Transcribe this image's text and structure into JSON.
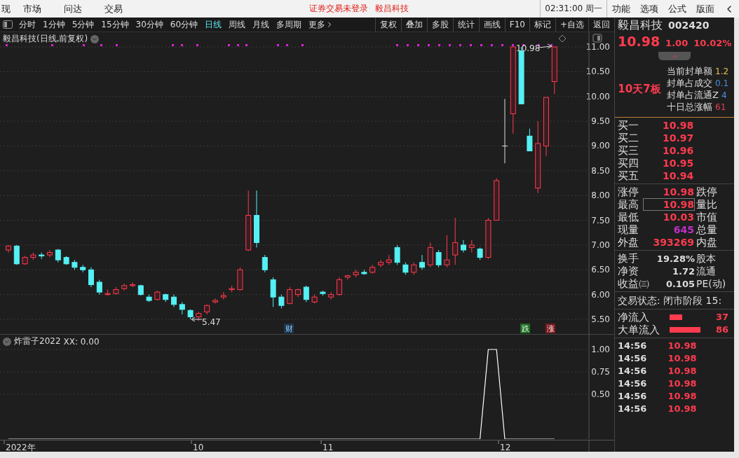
{
  "top_bar": {
    "menu_left": [
      "现",
      "市场",
      "问达",
      "交易"
    ],
    "notice": "证券交易未登录",
    "stock": "毅昌科技",
    "clock": "02:31:00 周一",
    "menu_right": [
      "功能",
      "选项",
      "公式",
      "版面"
    ]
  },
  "toolbar": {
    "periods": [
      {
        "label": "分时",
        "selected": false
      },
      {
        "label": "1分钟",
        "selected": false
      },
      {
        "label": "5分钟",
        "selected": false
      },
      {
        "label": "15分钟",
        "selected": false
      },
      {
        "label": "30分钟",
        "selected": false
      },
      {
        "label": "60分钟",
        "selected": false
      },
      {
        "label": "日线",
        "selected": true
      },
      {
        "label": "周线",
        "selected": false
      },
      {
        "label": "月线",
        "selected": false
      },
      {
        "label": "多周期",
        "selected": false
      },
      {
        "label": "更多",
        "selected": false
      }
    ],
    "tools": [
      "复权",
      "叠加",
      "多股",
      "统计",
      "画线",
      "F10",
      "标记",
      "+自选",
      "返回"
    ]
  },
  "chart": {
    "title": "毅昌科技(日线,前复权)",
    "high_note": "10.98",
    "low_note": "5.47",
    "markers": [
      {
        "label": "财",
        "kind": "finance"
      },
      {
        "label": "跌",
        "kind": "down"
      },
      {
        "label": "涨",
        "kind": "up"
      }
    ],
    "chart_data": {
      "type": "candlestick",
      "grid": true,
      "ylim": [
        5.5,
        11.0
      ],
      "yticks": [
        {
          "value": 11,
          "label": "11.00"
        },
        {
          "value": 10.5,
          "label": "10.50"
        },
        {
          "value": 10,
          "label": "10.00"
        },
        {
          "value": 9.5,
          "label": "9.50"
        },
        {
          "value": 9,
          "label": "9.00"
        },
        {
          "value": 8.5,
          "label": "8.50"
        },
        {
          "value": 8,
          "label": "8.00"
        },
        {
          "value": 7.5,
          "label": "7.50"
        },
        {
          "value": 7,
          "label": "7.00"
        },
        {
          "value": 6.5,
          "label": "6.50"
        },
        {
          "value": 6,
          "label": "6.00"
        },
        {
          "value": 5.5,
          "label": "5.50"
        }
      ],
      "categories": [
        null,
        null,
        null,
        null,
        null,
        null,
        null,
        null,
        null,
        null,
        null,
        null,
        null,
        null,
        null,
        null,
        null,
        null,
        null,
        null,
        null,
        null,
        null,
        null,
        null,
        null,
        null,
        null,
        null,
        null,
        null,
        null,
        null,
        null,
        null,
        null,
        null,
        null,
        null,
        null,
        null,
        null,
        null,
        null,
        null,
        null,
        null,
        null,
        null,
        null,
        null,
        null,
        null,
        null,
        null,
        null,
        null,
        null,
        null,
        null,
        null,
        null,
        null,
        null,
        null,
        null,
        null
      ],
      "ohlc": [
        [
          6.9,
          7.0,
          6.85,
          6.98
        ],
        [
          6.98,
          7.0,
          6.6,
          6.62
        ],
        [
          6.62,
          6.78,
          6.6,
          6.75
        ],
        [
          6.75,
          6.85,
          6.7,
          6.8
        ],
        [
          6.8,
          6.85,
          6.72,
          6.78
        ],
        [
          6.8,
          6.9,
          6.75,
          6.85
        ],
        [
          6.9,
          6.92,
          6.65,
          6.7
        ],
        [
          6.75,
          6.78,
          6.6,
          6.62
        ],
        [
          6.65,
          6.7,
          6.5,
          6.55
        ],
        [
          6.55,
          6.6,
          6.45,
          6.5
        ],
        [
          6.5,
          6.55,
          6.15,
          6.2
        ],
        [
          6.25,
          6.3,
          6.0,
          6.05
        ],
        [
          6.0,
          6.1,
          5.98,
          6.02
        ],
        [
          6.02,
          6.15,
          6.0,
          6.1
        ],
        [
          6.12,
          6.22,
          6.08,
          6.18
        ],
        [
          6.18,
          6.25,
          6.15,
          6.2
        ],
        [
          6.18,
          6.2,
          5.98,
          6.0
        ],
        [
          5.95,
          6.0,
          5.85,
          5.88
        ],
        [
          5.9,
          6.08,
          5.88,
          6.05
        ],
        [
          6.0,
          6.02,
          5.85,
          5.9
        ],
        [
          5.95,
          6.0,
          5.75,
          5.8
        ],
        [
          5.8,
          5.85,
          5.6,
          5.7
        ],
        [
          5.68,
          5.7,
          5.5,
          5.55
        ],
        [
          5.55,
          5.65,
          5.47,
          5.62
        ],
        [
          5.65,
          5.8,
          5.6,
          5.78
        ],
        [
          5.85,
          5.92,
          5.82,
          5.88
        ],
        [
          5.95,
          6.05,
          5.9,
          5.98
        ],
        [
          6.1,
          6.18,
          6.05,
          6.12
        ],
        [
          6.1,
          6.55,
          6.08,
          6.5
        ],
        [
          6.9,
          8.1,
          6.88,
          7.6
        ],
        [
          7.6,
          8.1,
          6.95,
          7.05
        ],
        [
          6.75,
          6.8,
          6.45,
          6.5
        ],
        [
          6.3,
          6.35,
          5.75,
          5.95
        ],
        [
          5.95,
          6.0,
          5.72,
          5.78
        ],
        [
          5.82,
          6.15,
          5.8,
          6.1
        ],
        [
          6.0,
          6.12,
          5.95,
          6.1
        ],
        [
          6.15,
          6.18,
          5.85,
          5.9
        ],
        [
          5.85,
          6.0,
          5.82,
          5.95
        ],
        [
          6.05,
          6.08,
          5.98,
          6.02
        ],
        [
          5.95,
          6.05,
          5.9,
          6.0
        ],
        [
          6.0,
          6.35,
          5.98,
          6.3
        ],
        [
          6.35,
          6.4,
          6.3,
          6.38
        ],
        [
          6.4,
          6.5,
          6.35,
          6.45
        ],
        [
          6.45,
          6.5,
          6.4,
          6.42
        ],
        [
          6.45,
          6.6,
          6.42,
          6.55
        ],
        [
          6.6,
          6.7,
          6.55,
          6.65
        ],
        [
          6.65,
          6.8,
          6.6,
          6.7
        ],
        [
          6.95,
          7.0,
          6.6,
          6.65
        ],
        [
          6.6,
          6.65,
          6.4,
          6.45
        ],
        [
          6.45,
          6.65,
          6.4,
          6.6
        ],
        [
          6.65,
          6.8,
          6.5,
          6.55
        ],
        [
          6.6,
          7.05,
          6.55,
          6.95
        ],
        [
          6.85,
          6.9,
          6.55,
          6.6
        ],
        [
          6.6,
          7.2,
          6.55,
          6.7
        ],
        [
          6.8,
          7.55,
          6.6,
          7.05
        ],
        [
          7.0,
          7.1,
          6.85,
          6.9
        ],
        [
          6.95,
          7.1,
          6.85,
          7.0
        ],
        [
          6.92,
          6.95,
          6.7,
          6.75
        ],
        [
          6.75,
          7.55,
          6.72,
          7.5
        ],
        [
          7.5,
          8.35,
          7.5,
          8.3
        ],
        [
          9.0,
          9.95,
          8.65,
          9.0
        ],
        [
          9.65,
          11.0,
          9.25,
          11.0
        ],
        [
          10.92,
          11.0,
          9.85,
          9.85
        ],
        [
          9.2,
          9.35,
          8.9,
          8.9
        ],
        [
          8.15,
          9.5,
          8.05,
          9.05
        ],
        [
          9.0,
          9.98,
          8.8,
          9.98
        ],
        [
          10.3,
          11.0,
          10.05,
          11.0
        ]
      ]
    }
  },
  "indicator": {
    "title": "炸雷子2022",
    "reading": ": 0.00",
    "chart_data": {
      "type": "line",
      "grid": true,
      "ylim": [
        -0.1641,
        1.0
      ],
      "yticks": [
        {
          "value": 1.0,
          "label": "1.00"
        },
        {
          "value": 0.75,
          "label": "0.75"
        },
        {
          "value": 0.5,
          "label": "0.50"
        }
      ],
      "categories": [
        null,
        null,
        null,
        null,
        null,
        null,
        null,
        null,
        null,
        null,
        null,
        null,
        null,
        null,
        null,
        null,
        null,
        null,
        null,
        null,
        null,
        null,
        null,
        null,
        null,
        null,
        null,
        null,
        null,
        null,
        null,
        null,
        null,
        null,
        null,
        null,
        null,
        null,
        null,
        null,
        null,
        null,
        null,
        null,
        null,
        null,
        null,
        null,
        null,
        null,
        null,
        null,
        null,
        null,
        null,
        null,
        null,
        null,
        null,
        null,
        null,
        null,
        null,
        null,
        null,
        null,
        null
      ],
      "series": [
        {
          "name": "XX",
          "color": "#ffffff",
          "values": [
            0,
            0,
            0,
            0,
            0,
            0,
            0,
            0,
            0,
            0,
            0,
            0,
            0,
            0,
            0,
            0,
            0,
            0,
            0,
            0,
            0,
            0,
            0,
            0,
            0,
            0,
            0,
            0,
            0,
            0,
            0,
            0,
            0,
            0,
            0,
            0,
            0,
            0,
            0,
            0,
            0,
            0,
            0,
            0,
            0,
            0,
            0,
            0,
            0,
            0,
            0,
            0,
            0,
            0,
            0,
            0,
            0,
            0,
            1,
            1,
            0,
            0,
            0,
            0,
            0,
            0,
            0
          ]
        }
      ]
    }
  },
  "time_axis": [
    "2022年",
    "10",
    "11",
    "12"
  ],
  "quote": {
    "name": "毅昌科技",
    "code": "002420",
    "price": "10.98",
    "change": "1.00",
    "percent": "10.02%"
  },
  "board_tag": "10天7板",
  "seal_stats": [
    {
      "label": "当前封单额",
      "value": "1.2",
      "color": "#e8c050"
    },
    {
      "label": "封单占成交",
      "value": "0.1",
      "color": "#4a90e0"
    },
    {
      "label": "封单占流通Z",
      "value": "4",
      "color": "#4a90e0"
    },
    {
      "label": "十日总涨幅",
      "value": "61",
      "color": "#e04050"
    }
  ],
  "order_book": [
    {
      "label": "买一",
      "price": "10.98"
    },
    {
      "label": "买二",
      "price": "10.97"
    },
    {
      "label": "买三",
      "price": "10.96"
    },
    {
      "label": "买四",
      "price": "10.95"
    },
    {
      "label": "买五",
      "price": "10.94"
    }
  ],
  "stats": [
    {
      "label": "涨停",
      "value": "10.98",
      "label2": "跌停",
      "color": "#ff3b4e",
      "highlighted": false
    },
    {
      "label": "最高",
      "value": "10.98",
      "label2": "量比",
      "color": "#ff3b4e",
      "highlighted": true
    },
    {
      "label": "最低",
      "value": "10.03",
      "label2": "市值",
      "color": "#ff3b4e",
      "highlighted": false
    },
    {
      "label": "现量",
      "value": "645",
      "label2": "总量",
      "color": "#c030c8",
      "highlighted": false
    },
    {
      "label": "外盘",
      "value": "393269",
      "label2": "内盘",
      "color": "#ff3b4e",
      "highlighted": false
    }
  ],
  "fundamentals": [
    {
      "label": "换手",
      "value": "19.28%",
      "label2": "股本"
    },
    {
      "label": "净资",
      "value": "1.72",
      "label2": "流通"
    },
    {
      "label": "收益㈢",
      "value": "0.105",
      "label2": "PE(动)"
    }
  ],
  "trade_status": "交易状态: 闭市阶段 15:",
  "flows": [
    {
      "label": "净流入",
      "value": "37"
    },
    {
      "label": "大单流入",
      "value": "86"
    }
  ],
  "ticks": [
    {
      "time": "14:56",
      "price": "10.98"
    },
    {
      "time": "14:56",
      "price": "10.98"
    },
    {
      "time": "14:56",
      "price": "10.98"
    },
    {
      "time": "14:56",
      "price": "10.98"
    },
    {
      "time": "14:56",
      "price": "10.98"
    },
    {
      "time": "14:56",
      "price": "10.98"
    }
  ]
}
